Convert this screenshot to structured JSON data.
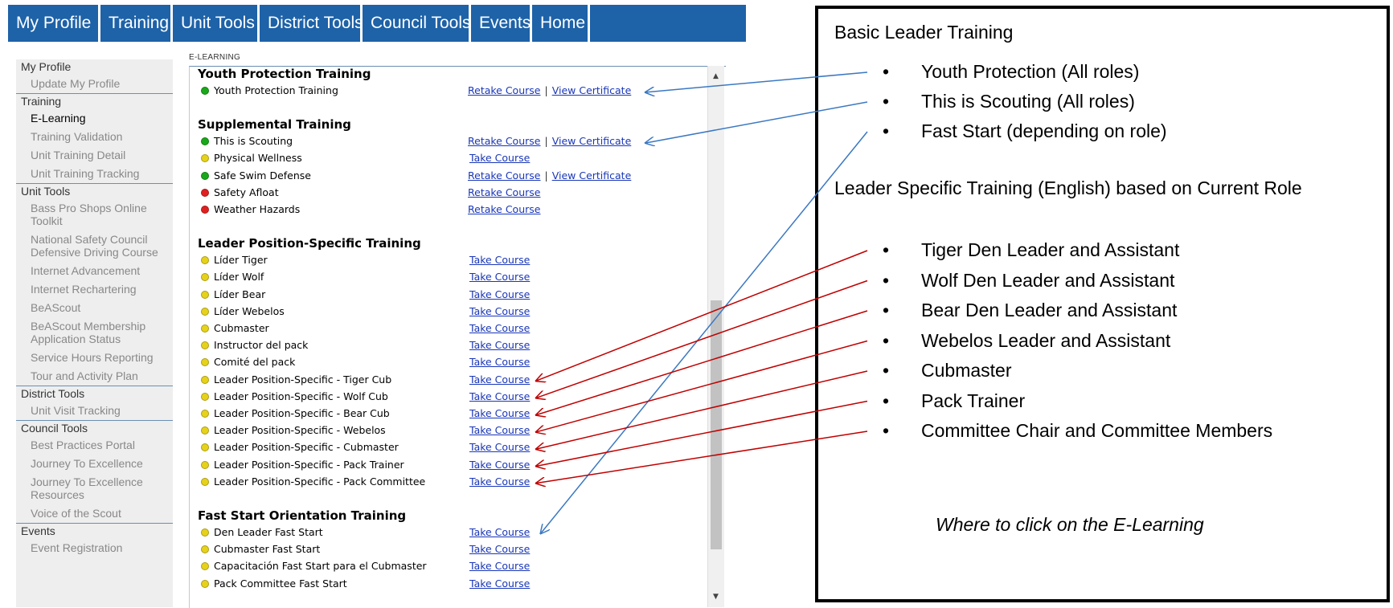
{
  "nav": {
    "tabs": [
      "My Profile",
      "Training",
      "Unit Tools",
      "District Tools",
      "Council Tools",
      "Events",
      "Home",
      ""
    ],
    "color": "#1e62a8"
  },
  "sidebar": {
    "sections": [
      {
        "label": "My Profile",
        "items": [
          {
            "label": "Update My Profile"
          }
        ]
      },
      {
        "label": "Training",
        "items": [
          {
            "label": "E-Learning",
            "active": true
          },
          {
            "label": "Training Validation"
          },
          {
            "label": "Unit Training Detail"
          },
          {
            "label": "Unit Training Tracking"
          }
        ]
      },
      {
        "label": "Unit Tools",
        "items": [
          {
            "label": "Bass Pro Shops Online Toolkit"
          },
          {
            "label": "National Safety Council Defensive Driving Course"
          },
          {
            "label": "Internet Advancement"
          },
          {
            "label": "Internet Rechartering"
          },
          {
            "label": "BeAScout"
          },
          {
            "label": "BeAScout Membership Application Status"
          },
          {
            "label": "Service Hours Reporting"
          },
          {
            "label": "Tour and Activity Plan"
          }
        ]
      },
      {
        "label": "District Tools",
        "items": [
          {
            "label": "Unit Visit Tracking"
          }
        ]
      },
      {
        "label": "Council Tools",
        "items": [
          {
            "label": "Best Practices Portal"
          },
          {
            "label": "Journey To Excellence"
          },
          {
            "label": "Journey To Excellence Resources"
          },
          {
            "label": "Voice of the Scout"
          }
        ]
      },
      {
        "label": "Events",
        "items": [
          {
            "label": "Event Registration"
          }
        ]
      }
    ]
  },
  "main": {
    "section_label": "E-LEARNING",
    "links": {
      "retake": "Retake Course",
      "take": "Take Course",
      "cert": "View Certificate",
      "sep": "|"
    },
    "groups": [
      {
        "title": "Youth Protection Training",
        "courses": [
          {
            "name": "Youth Protection Training",
            "status": "green",
            "action": "retake",
            "certificate": true
          }
        ]
      },
      {
        "title": "Supplemental Training",
        "courses": [
          {
            "name": "This is Scouting",
            "status": "green",
            "action": "retake",
            "certificate": true
          },
          {
            "name": "Physical Wellness",
            "status": "yellow",
            "action": "take"
          },
          {
            "name": "Safe Swim Defense",
            "status": "green",
            "action": "retake",
            "certificate": true
          },
          {
            "name": "Safety Afloat",
            "status": "red",
            "action": "retake"
          },
          {
            "name": "Weather Hazards",
            "status": "red",
            "action": "retake"
          }
        ]
      },
      {
        "title": "Leader Position-Specific Training",
        "courses": [
          {
            "name": "Líder Tiger",
            "status": "yellow",
            "action": "take"
          },
          {
            "name": "Líder Wolf",
            "status": "yellow",
            "action": "take"
          },
          {
            "name": "Líder Bear",
            "status": "yellow",
            "action": "take"
          },
          {
            "name": "Líder Webelos",
            "status": "yellow",
            "action": "take"
          },
          {
            "name": "Cubmaster",
            "status": "yellow",
            "action": "take"
          },
          {
            "name": "Instructor del pack",
            "status": "yellow",
            "action": "take"
          },
          {
            "name": "Comité del pack",
            "status": "yellow",
            "action": "take"
          },
          {
            "name": "Leader Position-Specific - Tiger Cub",
            "status": "yellow",
            "action": "take"
          },
          {
            "name": "Leader Position-Specific - Wolf Cub",
            "status": "yellow",
            "action": "take"
          },
          {
            "name": "Leader Position-Specific - Bear Cub",
            "status": "yellow",
            "action": "take"
          },
          {
            "name": "Leader Position-Specific - Webelos",
            "status": "yellow",
            "action": "take"
          },
          {
            "name": "Leader Position-Specific - Cubmaster",
            "status": "yellow",
            "action": "take"
          },
          {
            "name": "Leader Position-Specific - Pack Trainer",
            "status": "yellow",
            "action": "take"
          },
          {
            "name": "Leader Position-Specific - Pack Committee",
            "status": "yellow",
            "action": "take"
          }
        ]
      },
      {
        "title": "Fast Start Orientation Training",
        "courses": [
          {
            "name": "Den Leader Fast Start",
            "status": "yellow",
            "action": "take"
          },
          {
            "name": "Cubmaster Fast Start",
            "status": "yellow",
            "action": "take"
          },
          {
            "name": "Capacitación Fast Start para el Cubmaster",
            "status": "yellow",
            "action": "take"
          },
          {
            "name": "Pack Committee Fast Start",
            "status": "yellow",
            "action": "take"
          }
        ]
      }
    ]
  },
  "status_colors": {
    "green": "#19a819",
    "yellow": "#e6d21a",
    "red": "#e02020"
  },
  "callout": {
    "heading1": "Basic Leader Training",
    "bullets1": [
      "Youth Protection (All roles)",
      "This is Scouting (All roles)",
      "Fast Start (depending on role)"
    ],
    "heading2": "Leader Specific Training (English) based on Current Role",
    "bullets2": [
      "Tiger Den Leader and Assistant",
      "Wolf Den Leader and Assistant",
      "Bear Den Leader and Assistant",
      "Webelos Leader and Assistant",
      "Cubmaster",
      "Pack Trainer",
      "Committee Chair and Committee Members"
    ],
    "caption": "Where to click on the E-Learning",
    "bullet_glyph": "•"
  },
  "arrow_colors": {
    "basic": "#3b78c2",
    "leader": "#c00000"
  }
}
